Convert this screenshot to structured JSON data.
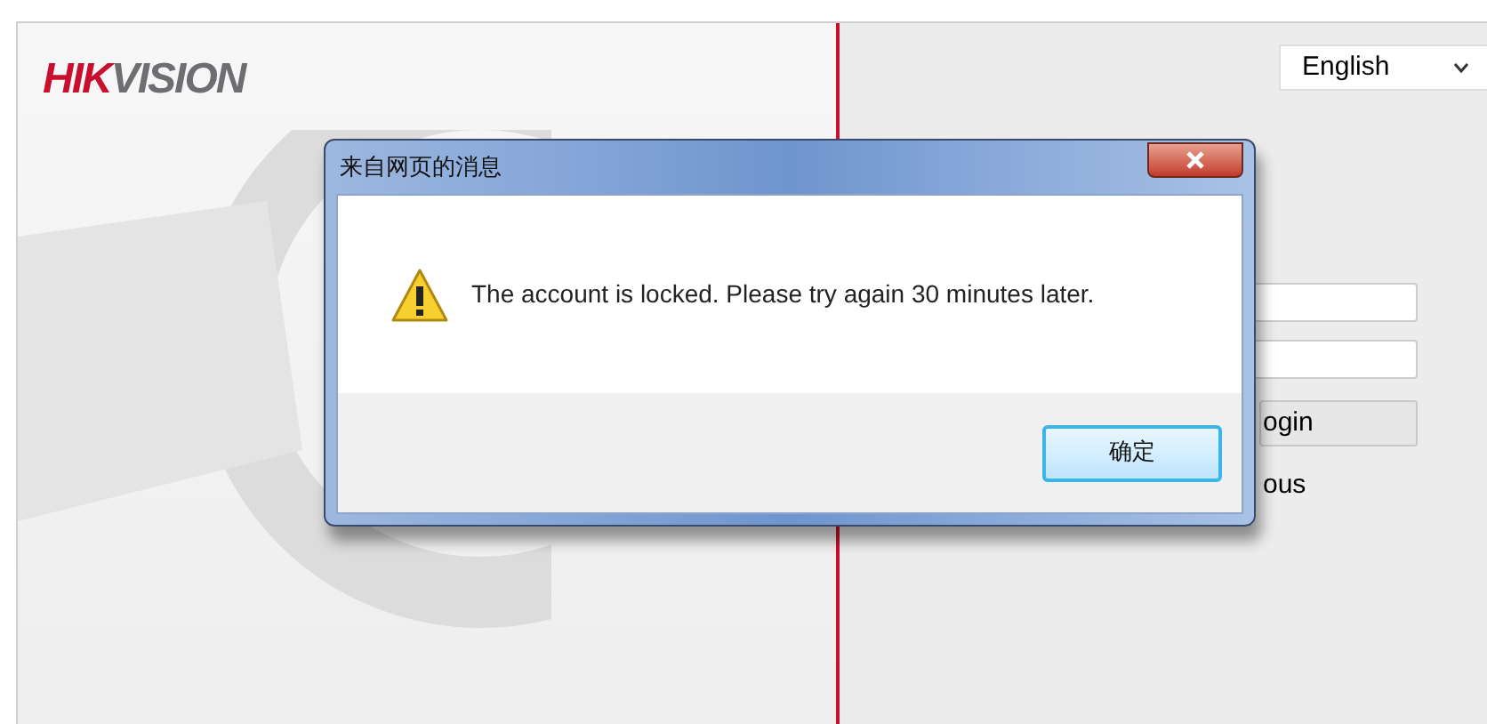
{
  "header": {
    "logo": "HIKVISION",
    "language": {
      "value": "English"
    }
  },
  "login_form": {
    "login_button": "ogin",
    "option_label": "ous"
  },
  "dialog": {
    "title": "来自网页的消息",
    "message": "The account is locked. Please try again 30 minutes later.",
    "buttons": [
      {
        "label": "确定",
        "selected": true
      }
    ]
  }
}
